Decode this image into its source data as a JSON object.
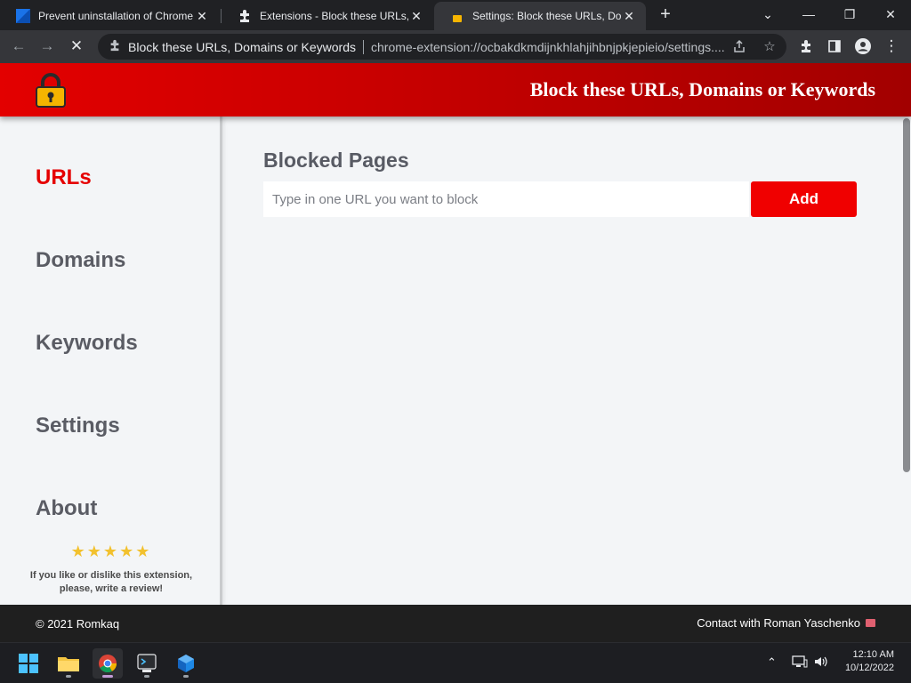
{
  "browser": {
    "tabs": [
      {
        "title": "Prevent uninstallation of Chrome",
        "icon": "blue-square-favicon",
        "active": false
      },
      {
        "title": "Extensions - Block these URLs, Do",
        "icon": "puzzle-piece-icon",
        "active": false
      },
      {
        "title": "Settings: Block these URLs, Doma",
        "icon": "lock-favicon",
        "active": true
      }
    ],
    "tab_close": "✕",
    "new_tab": "+",
    "window": {
      "dropdown": "⌄",
      "minimize": "—",
      "restore": "❐",
      "close": "✕"
    },
    "toolbar": {
      "back": "←",
      "forward": "→",
      "stop": "✕",
      "site_title": "Block these URLs, Domains or Keywords",
      "url": "chrome-extension://ocbakdkmdijnkhlahjihbnjpkjepieio/settings...."
    }
  },
  "page": {
    "header_title": "Block these URLs, Domains or Keywords",
    "nav": [
      {
        "label": "URLs",
        "active": true
      },
      {
        "label": "Domains",
        "active": false
      },
      {
        "label": "Keywords",
        "active": false
      },
      {
        "label": "Settings",
        "active": false
      },
      {
        "label": "About",
        "active": false
      }
    ],
    "rating": {
      "stars": "★★★★★",
      "value": 5,
      "max": 5
    },
    "review_text_line1": "If you like or dislike this extension,",
    "review_text_line2": "please, write a review!",
    "main_title": "Blocked Pages",
    "input_placeholder": "Type in one URL you want to block",
    "input_value": "",
    "add_button": "Add",
    "footer_left": "© 2021 Romkaq",
    "footer_right": "Contact with Roman Yaschenko"
  },
  "taskbar": {
    "apps": [
      "start-button",
      "file-explorer",
      "chrome",
      "app-dark",
      "app-blue-cube"
    ],
    "tray_chevron": "⌃",
    "time": "12:10 AM",
    "date": "10/12/2022"
  },
  "colors": {
    "brand_red": "#e30000",
    "add_button": "#f00000",
    "active_nav": "#e50000",
    "star": "#f2c12e"
  }
}
